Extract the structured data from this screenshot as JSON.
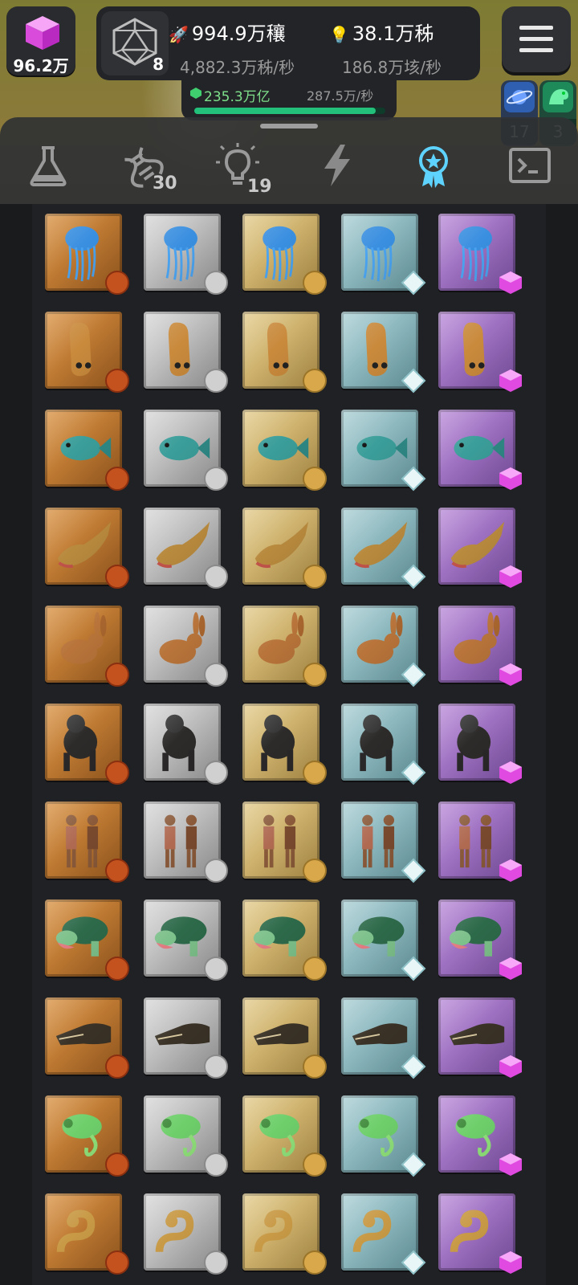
{
  "header": {
    "gem_count": "96.2万",
    "dice_level": "8",
    "resource_a_total": "994.9万穰",
    "resource_a_rate": "4,882.3万秭/秒",
    "resource_b_total": "38.1万秭",
    "resource_b_rate": "186.8万垓/秒",
    "sub_total": "235.3万亿",
    "sub_rate": "287.5万/秒",
    "sub_progress": 0.95
  },
  "badges": {
    "planet_count": "17",
    "dino_count": "3"
  },
  "tabs": [
    {
      "name": "lab",
      "count": ""
    },
    {
      "name": "dna",
      "count": "30"
    },
    {
      "name": "idea",
      "count": "19"
    },
    {
      "name": "energy",
      "count": ""
    },
    {
      "name": "achievements",
      "count": ""
    },
    {
      "name": "console",
      "count": ""
    }
  ],
  "tiers": [
    "bronze",
    "silver",
    "gold",
    "diamond",
    "purple"
  ],
  "creatures": [
    "jellyfish",
    "worm",
    "fish",
    "salamander",
    "rabbit",
    "gorilla",
    "humans",
    "turtle",
    "crocodile",
    "chameleon",
    "snake"
  ],
  "colors": {
    "bronze": "#b8742e",
    "silver": "#b9b9b9",
    "gold": "#cdb16a",
    "diamond": "#7fb1b9",
    "purple": "#9a6cc0",
    "accent_green": "#22c07a"
  }
}
